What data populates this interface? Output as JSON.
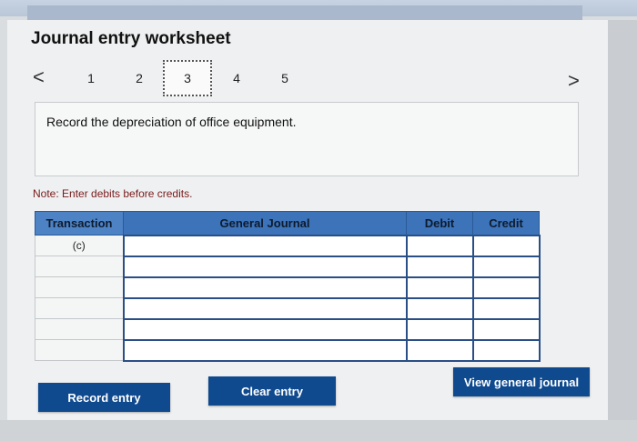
{
  "worksheet": {
    "title": "Journal entry worksheet",
    "pager": {
      "prev": "<",
      "next": ">",
      "pages": [
        "1",
        "2",
        "3",
        "4",
        "5"
      ],
      "active_page": "3"
    },
    "prompt": "Record the depreciation of office equipment.",
    "note": "Note: Enter debits before credits."
  },
  "table": {
    "headers": {
      "transaction": "Transaction",
      "general_journal": "General Journal",
      "debit": "Debit",
      "credit": "Credit"
    },
    "rows": [
      {
        "transaction": "(c)"
      },
      {
        "transaction": ""
      },
      {
        "transaction": ""
      },
      {
        "transaction": ""
      },
      {
        "transaction": ""
      },
      {
        "transaction": ""
      }
    ]
  },
  "buttons": {
    "record": "Record entry",
    "clear": "Clear entry",
    "view": "View general journal"
  },
  "colors": {
    "header_blue": "#3d73b9",
    "button_blue": "#0f4a8f",
    "note_red": "#7a1a1a"
  }
}
